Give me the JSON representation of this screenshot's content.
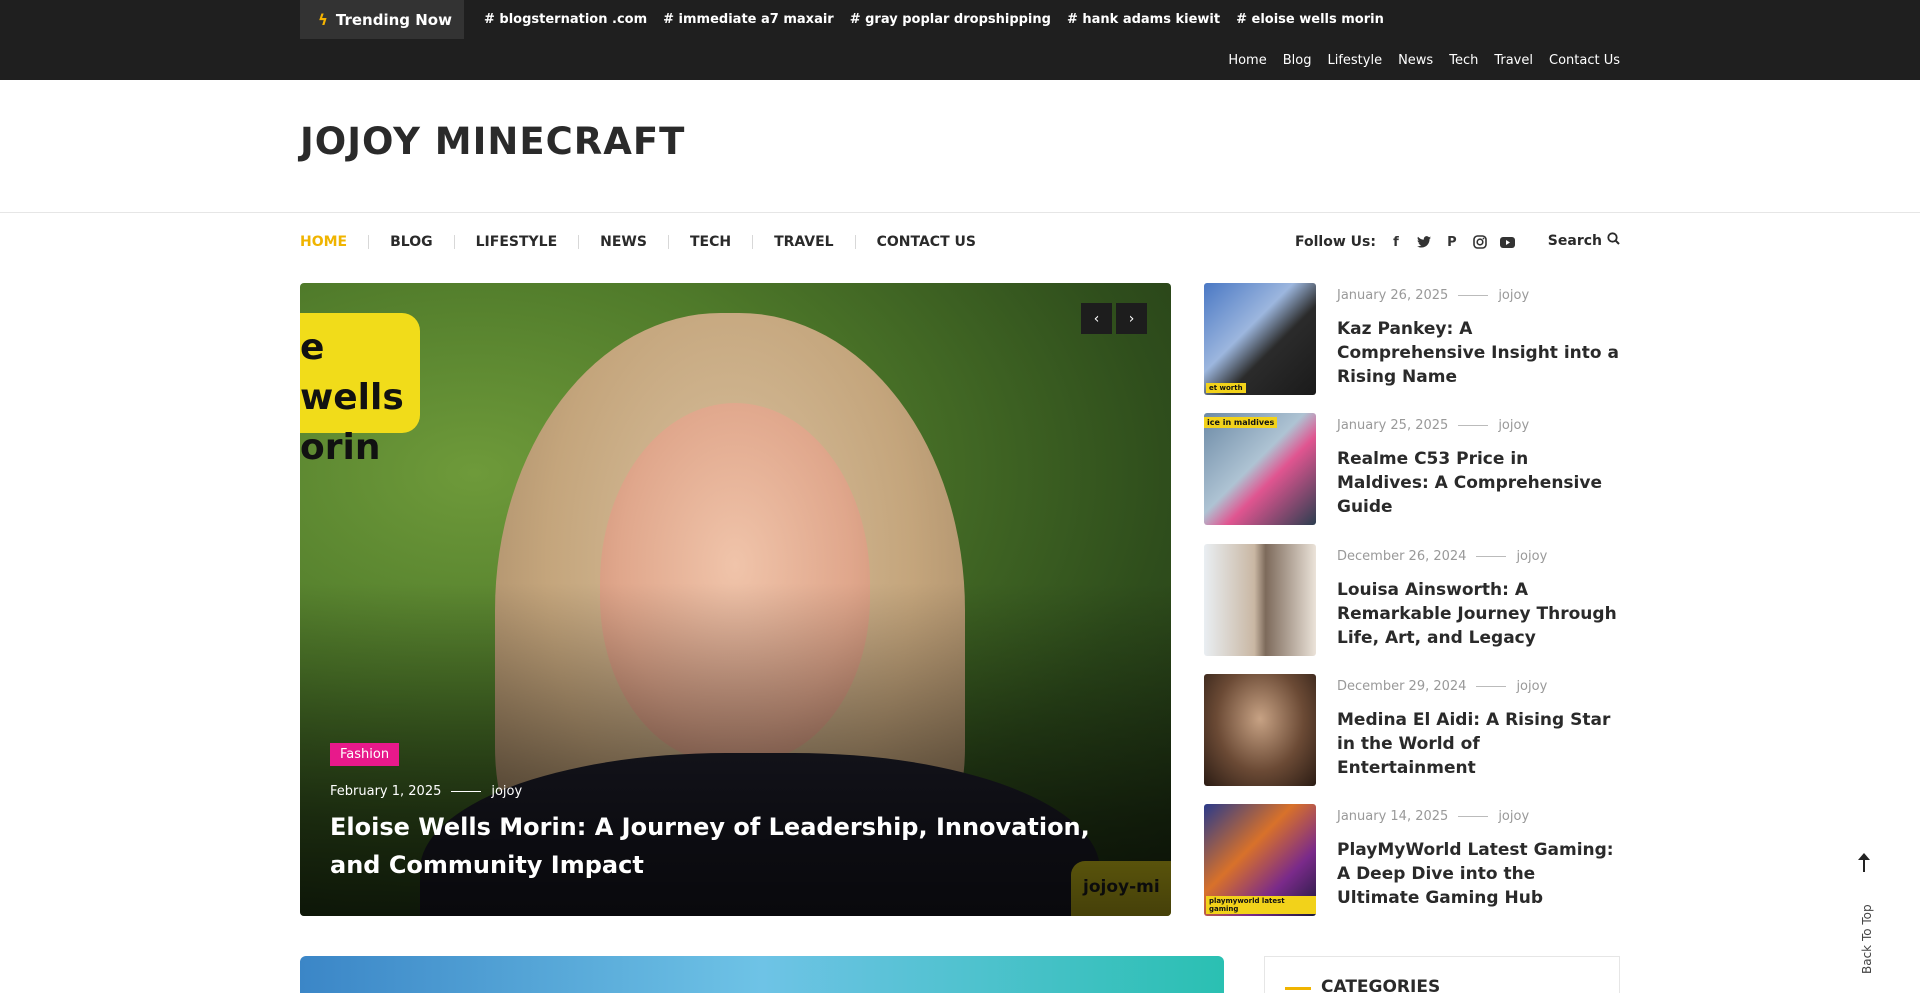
{
  "trending": {
    "label": "Trending Now",
    "tags": [
      "# blogsternation .com",
      "# immediate a7 maxair",
      "# gray poplar dropshipping",
      "# hank adams kiewit",
      "# eloise wells morin"
    ]
  },
  "top_nav": [
    "Home",
    "Blog",
    "Lifestyle",
    "News",
    "Tech",
    "Travel",
    "Contact Us"
  ],
  "site_title": "JOJOY MINECRAFT",
  "main_nav": [
    "HOME",
    "BLOG",
    "LIFESTYLE",
    "NEWS",
    "TECH",
    "TRAVEL",
    "CONTACT US"
  ],
  "follow": {
    "label": "Follow Us:",
    "icons": [
      "facebook-icon",
      "twitter-icon",
      "pinterest-icon",
      "instagram-icon",
      "youtube-icon"
    ]
  },
  "search_label": "Search",
  "hero": {
    "category": "Fashion",
    "date": "February 1, 2025",
    "author": "jojoy",
    "title": "Eloise Wells Morin: A Journey of Leadership, Innovation, and Community Impact",
    "sticker_text": "e wells\norin",
    "watermark": "jojoy-mi"
  },
  "side_posts": [
    {
      "date": "January 26, 2025",
      "author": "jojoy",
      "title": "Kaz Pankey: A Comprehensive Insight into a Rising Name",
      "thumb_tag": "et worth"
    },
    {
      "date": "January 25, 2025",
      "author": "jojoy",
      "title": "Realme C53 Price in Maldives: A Comprehensive Guide",
      "thumb_tag": "ice in maldives"
    },
    {
      "date": "December 26, 2024",
      "author": "jojoy",
      "title": "Louisa Ainsworth: A Remarkable Journey Through Life, Art, and Legacy",
      "thumb_tag": ""
    },
    {
      "date": "December 29, 2024",
      "author": "jojoy",
      "title": "Medina El Aidi: A Rising Star in the World of Entertainment",
      "thumb_tag": ""
    },
    {
      "date": "January 14, 2025",
      "author": "jojoy",
      "title": "PlayMyWorld Latest Gaming: A Deep Dive into the Ultimate Gaming Hub",
      "thumb_tag": "playmyworld latest gaming"
    }
  ],
  "categories_heading": "CATEGORIES",
  "back_to_top": "Back To Top",
  "colors": {
    "accent": "#f0b400",
    "topbar": "#1f1f1f",
    "category_badge": "#e8198b"
  }
}
